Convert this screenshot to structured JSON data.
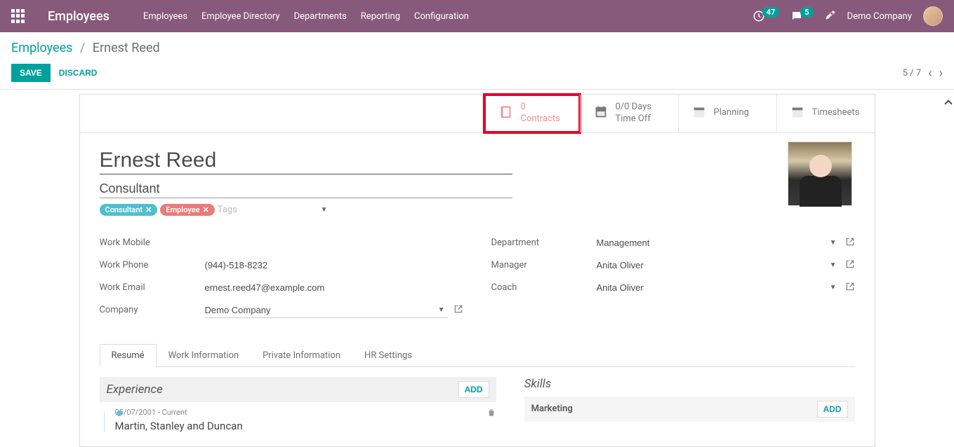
{
  "nav": {
    "app_title": "Employees",
    "links": [
      "Employees",
      "Employee Directory",
      "Departments",
      "Reporting",
      "Configuration"
    ],
    "clock_badge": "47",
    "chat_badge": "5",
    "company": "Demo Company"
  },
  "breadcrumb": {
    "root": "Employees",
    "current": "Ernest Reed"
  },
  "actions": {
    "save": "SAVE",
    "discard": "DISCARD",
    "pager": "5 / 7"
  },
  "stats": {
    "contracts": {
      "value": "0",
      "label": "Contracts"
    },
    "timeoff": {
      "value": "0/0 Days",
      "label": "Time Off"
    },
    "planning": {
      "label": "Planning"
    },
    "timesheets": {
      "label": "Timesheets"
    }
  },
  "employee": {
    "name": "Ernest Reed",
    "title": "Consultant",
    "tags": {
      "t1": "Consultant",
      "t2": "Employee",
      "placeholder": "Tags"
    },
    "left": {
      "work_mobile_label": "Work Mobile",
      "work_mobile": "",
      "work_phone_label": "Work Phone",
      "work_phone": "(944)-518-8232",
      "work_email_label": "Work Email",
      "work_email": "ernest.reed47@example.com",
      "company_label": "Company",
      "company": "Demo Company"
    },
    "right": {
      "department_label": "Department",
      "department": "Management",
      "manager_label": "Manager",
      "manager": "Anita Oliver",
      "coach_label": "Coach",
      "coach": "Anita Oliver"
    }
  },
  "tabs": {
    "t1": "Resumé",
    "t2": "Work Information",
    "t3": "Private Information",
    "t4": "HR Settings"
  },
  "resume": {
    "experience_title": "Experience",
    "add": "ADD",
    "item": {
      "dates": "05/07/2001 - Current",
      "company": "Martin, Stanley and Duncan"
    }
  },
  "skills": {
    "title": "Skills",
    "group": "Marketing",
    "add": "ADD"
  }
}
